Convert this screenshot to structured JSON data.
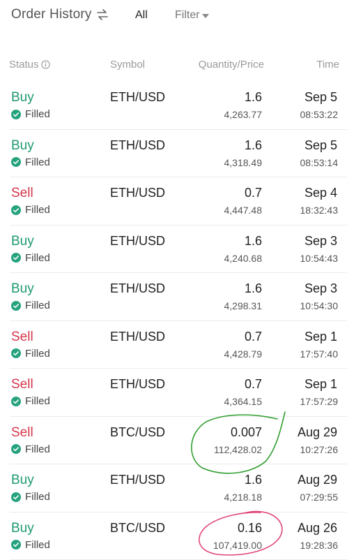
{
  "header": {
    "title": "Order History",
    "all_tab": "All",
    "filter_label": "Filter"
  },
  "columns": {
    "status": "Status",
    "symbol": "Symbol",
    "qty_price": "Quantity/Price",
    "time": "Time"
  },
  "colors": {
    "buy": "#1e9a6e",
    "sell": "#d6364a",
    "filled_check": "#26a37e",
    "annotation_green": "#2f9e2f",
    "annotation_pink": "#e0457a"
  },
  "orders": [
    {
      "side": "Buy",
      "status": "Filled",
      "symbol": "ETH/USD",
      "quantity": "1.6",
      "price": "4,263.77",
      "date": "Sep 5",
      "time": "08:53:22"
    },
    {
      "side": "Buy",
      "status": "Filled",
      "symbol": "ETH/USD",
      "quantity": "1.6",
      "price": "4,318.49",
      "date": "Sep 5",
      "time": "08:53:14"
    },
    {
      "side": "Sell",
      "status": "Filled",
      "symbol": "ETH/USD",
      "quantity": "0.7",
      "price": "4,447.48",
      "date": "Sep 4",
      "time": "18:32:43"
    },
    {
      "side": "Buy",
      "status": "Filled",
      "symbol": "ETH/USD",
      "quantity": "1.6",
      "price": "4,240.68",
      "date": "Sep 3",
      "time": "10:54:43"
    },
    {
      "side": "Buy",
      "status": "Filled",
      "symbol": "ETH/USD",
      "quantity": "1.6",
      "price": "4,298.31",
      "date": "Sep 3",
      "time": "10:54:30"
    },
    {
      "side": "Sell",
      "status": "Filled",
      "symbol": "ETH/USD",
      "quantity": "0.7",
      "price": "4,428.79",
      "date": "Sep 1",
      "time": "17:57:40"
    },
    {
      "side": "Sell",
      "status": "Filled",
      "symbol": "ETH/USD",
      "quantity": "0.7",
      "price": "4,364.15",
      "date": "Sep 1",
      "time": "17:57:29"
    },
    {
      "side": "Sell",
      "status": "Filled",
      "symbol": "BTC/USD",
      "quantity": "0.007",
      "price": "112,428.02",
      "date": "Aug 29",
      "time": "10:27:26"
    },
    {
      "side": "Buy",
      "status": "Filled",
      "symbol": "ETH/USD",
      "quantity": "1.6",
      "price": "4,218.18",
      "date": "Aug 29",
      "time": "07:29:55"
    },
    {
      "side": "Buy",
      "status": "Filled",
      "symbol": "BTC/USD",
      "quantity": "0.16",
      "price": "107,419.00",
      "date": "Aug 26",
      "time": "19:28:36"
    }
  ]
}
